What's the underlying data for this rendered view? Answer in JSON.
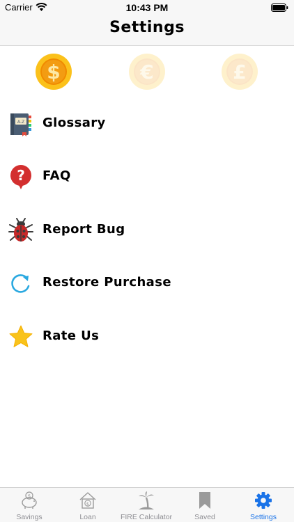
{
  "status_bar": {
    "carrier": "Carrier",
    "time": "10:43 PM"
  },
  "nav": {
    "title": "Settings"
  },
  "currencies": [
    {
      "name": "dollar",
      "symbol": "$",
      "selected": true
    },
    {
      "name": "euro",
      "symbol": "€",
      "selected": false
    },
    {
      "name": "pound",
      "symbol": "£",
      "selected": false
    }
  ],
  "menu": {
    "items": [
      {
        "label": "Glossary",
        "icon": "glossary-book-icon"
      },
      {
        "label": "FAQ",
        "icon": "question-bubble-icon"
      },
      {
        "label": "Report Bug",
        "icon": "bug-icon"
      },
      {
        "label": "Restore Purchase",
        "icon": "restore-arrow-icon"
      },
      {
        "label": "Rate Us",
        "icon": "star-icon"
      }
    ]
  },
  "tabs": [
    {
      "label": "Savings",
      "icon": "piggy-bank-icon",
      "active": false
    },
    {
      "label": "Loan",
      "icon": "house-dollar-icon",
      "active": false
    },
    {
      "label": "FIRE Calculator",
      "icon": "palm-tree-icon",
      "active": false
    },
    {
      "label": "Saved",
      "icon": "bookmark-icon",
      "active": false
    },
    {
      "label": "Settings",
      "icon": "gear-icon",
      "active": true
    }
  ],
  "colors": {
    "accent": "#1a73e8",
    "coin": "#f5b700",
    "bug": "#c62828",
    "faq": "#d32f2f",
    "star": "#f9c31b",
    "restore": "#29a8e0"
  }
}
